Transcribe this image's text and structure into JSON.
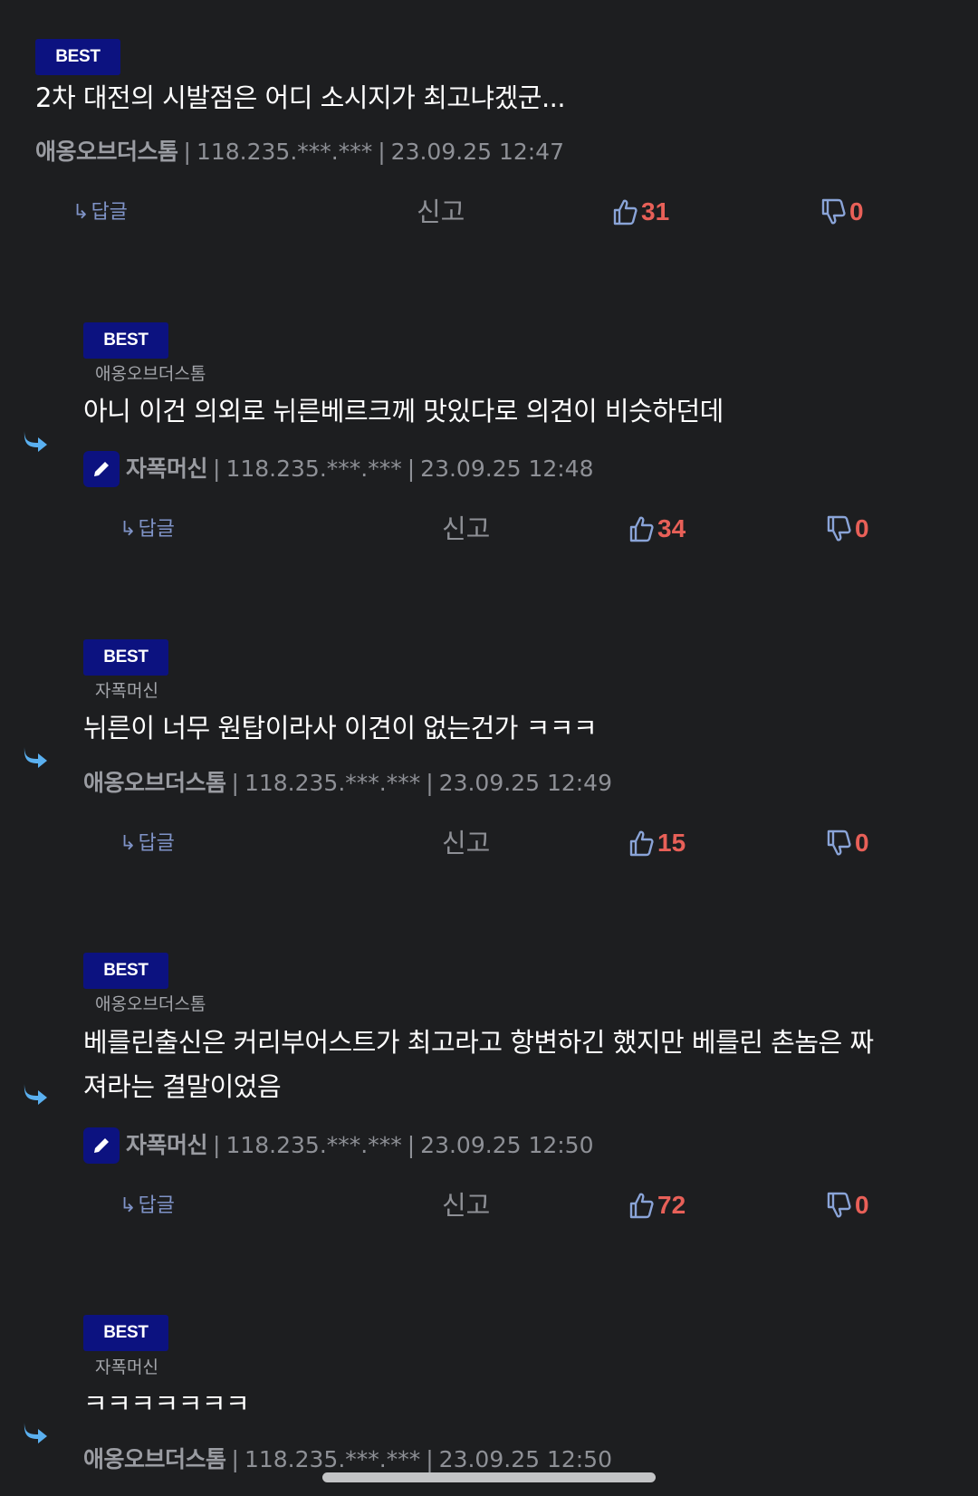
{
  "colors": {
    "background": "#1d1e20",
    "best_badge": "#0c1280",
    "reply_link": "#7f93c7",
    "vote_count": "#e86058",
    "reply_arrow": "#5ab0f0"
  },
  "comments": [
    {
      "badge": "BEST",
      "reply_to": "",
      "body_lines": [
        "2차 대전의 시발점은 어디 소시지가 최고냐겠군..."
      ],
      "author": "애옹오브더스톰",
      "ip": "118.235.***.***",
      "datetime": "23.09.25 12:47",
      "reply_label": "답글",
      "report_label": "신고",
      "likes": "31",
      "dislikes": "0"
    },
    {
      "badge": "BEST",
      "reply_to": "애옹오브더스톰",
      "body_lines": [
        "아니 이건 의외로 뉘른베르크께 맛있다로 의견이 비슷하던데"
      ],
      "author": "자폭머신",
      "ip": "118.235.***.***",
      "datetime": "23.09.25 12:48",
      "reply_label": "답글",
      "report_label": "신고",
      "likes": "34",
      "dislikes": "0"
    },
    {
      "badge": "BEST",
      "reply_to": "자폭머신",
      "body_lines": [
        "뉘른이 너무 원탑이라사 이견이 없는건가 ㅋㅋㅋ"
      ],
      "author": "애옹오브더스톰",
      "ip": "118.235.***.***",
      "datetime": "23.09.25 12:49",
      "reply_label": "답글",
      "report_label": "신고",
      "likes": "15",
      "dislikes": "0"
    },
    {
      "badge": "BEST",
      "reply_to": "애옹오브더스톰",
      "body_lines": [
        "베를린출신은 커리부어스트가 최고라고 항변하긴 했지만 베를린 촌놈은 짜",
        "져라는 결말이었음"
      ],
      "author": "자폭머신",
      "ip": "118.235.***.***",
      "datetime": "23.09.25 12:50",
      "reply_label": "답글",
      "report_label": "신고",
      "likes": "72",
      "dislikes": "0"
    },
    {
      "badge": "BEST",
      "reply_to": "자폭머신",
      "body_lines": [
        "ㅋㅋㅋㅋㅋㅋㅋ"
      ],
      "author": "애옹오브더스톰",
      "ip": "118.235.***.***",
      "datetime": "23.09.25 12:50"
    }
  ]
}
